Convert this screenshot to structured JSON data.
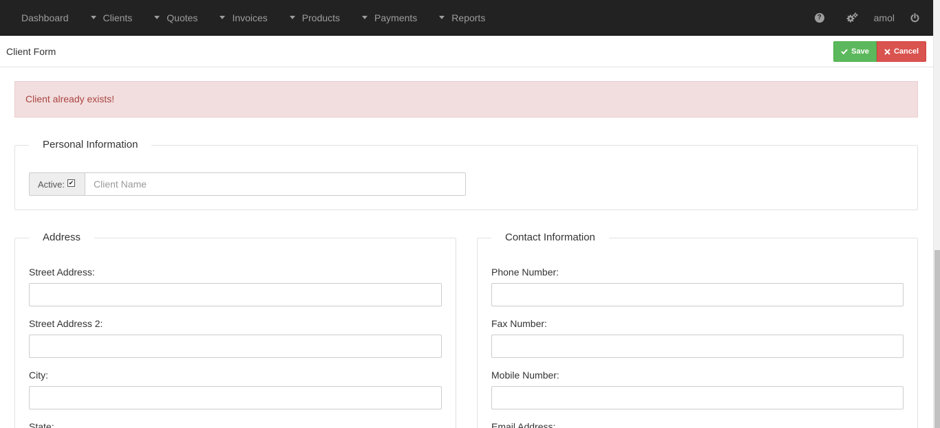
{
  "nav": {
    "items": [
      {
        "label": "Dashboard",
        "dropdown": false
      },
      {
        "label": "Clients",
        "dropdown": true
      },
      {
        "label": "Quotes",
        "dropdown": true
      },
      {
        "label": "Invoices",
        "dropdown": true
      },
      {
        "label": "Products",
        "dropdown": true
      },
      {
        "label": "Payments",
        "dropdown": true
      },
      {
        "label": "Reports",
        "dropdown": true
      }
    ],
    "right": {
      "help_icon": "question-circle-icon",
      "settings_icon": "cogs-icon",
      "user": "amol",
      "logout_icon": "power-off-icon"
    }
  },
  "header": {
    "title": "Client Form",
    "save_label": "Save",
    "cancel_label": "Cancel"
  },
  "alert": {
    "message": "Client already exists!"
  },
  "personal": {
    "legend": "Personal Information",
    "active_label": "Active:",
    "active_checked": true,
    "client_name_placeholder": "Client Name",
    "client_name_value": ""
  },
  "address": {
    "legend": "Address",
    "fields": [
      {
        "label": "Street Address:",
        "value": ""
      },
      {
        "label": "Street Address 2:",
        "value": ""
      },
      {
        "label": "City:",
        "value": ""
      },
      {
        "label": "State:",
        "value": ""
      }
    ]
  },
  "contact": {
    "legend": "Contact Information",
    "fields": [
      {
        "label": "Phone Number:",
        "value": ""
      },
      {
        "label": "Fax Number:",
        "value": ""
      },
      {
        "label": "Mobile Number:",
        "value": ""
      },
      {
        "label": "Email Address:",
        "value": ""
      }
    ]
  },
  "colors": {
    "navbar": "#222222",
    "save": "#5cb85c",
    "cancel": "#d9534f",
    "alert_bg": "#f2dede",
    "alert_text": "#a94442"
  }
}
